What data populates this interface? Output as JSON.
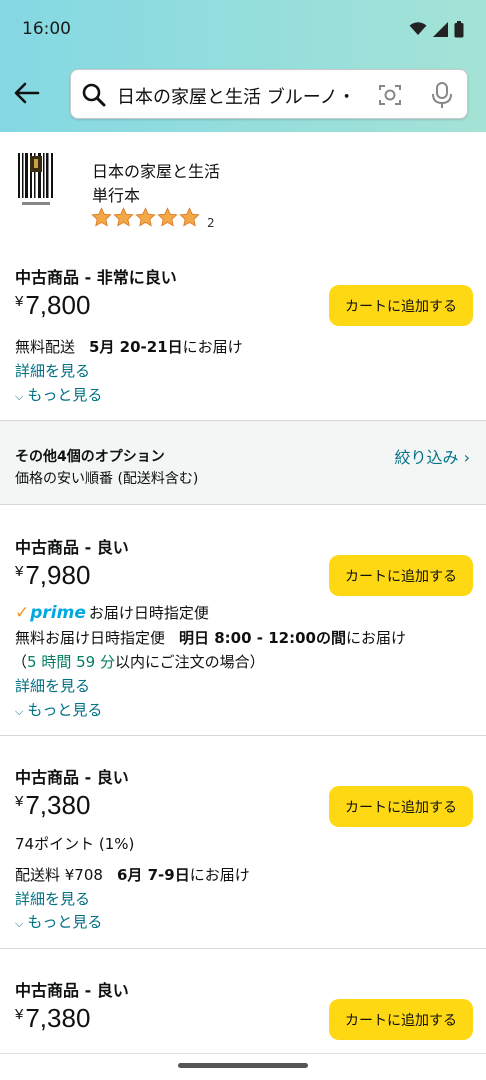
{
  "status": {
    "time": "16:00",
    "icons": [
      "wifi-icon",
      "signal-icon",
      "battery-icon"
    ]
  },
  "search": {
    "query": "日本の家屋と生活 ブルーノ・タウト"
  },
  "product": {
    "title": "日本の家屋と生活",
    "format": "単行本",
    "rating_stars": 5,
    "rating_count": "2"
  },
  "offers": [
    {
      "condition": "中古商品 - 非常に良い",
      "yen": "¥",
      "price": "7,800",
      "cart": "カートに追加する",
      "shipping_label": "無料配送",
      "delivery_date": "5月 20-21日",
      "delivery_suffix": "にお届け",
      "details": "詳細を見る",
      "more": "もっと見る"
    },
    {
      "condition": "中古商品 - 良い",
      "yen": "¥",
      "price": "7,980",
      "cart": "カートに追加する",
      "prime_logo": "prime",
      "prime_text": "お届け日時指定便",
      "shipping_label": "無料お届け日時指定便",
      "delivery_date": "明日 8:00 - 12:00の間",
      "delivery_suffix": "にお届け",
      "order_within_open": "（",
      "order_within_time": "5 時間 59 分",
      "order_within_suffix": "以内にご注文の場合）",
      "details": "詳細を見る",
      "more": "もっと見る"
    },
    {
      "condition": "中古商品 - 良い",
      "yen": "¥",
      "price": "7,380",
      "cart": "カートに追加する",
      "points": "74ポイント (1%)",
      "shipping_label": "配送料 ¥708",
      "delivery_date": "6月 7-9日",
      "delivery_suffix": "にお届け",
      "details": "詳細を見る",
      "more": "もっと見る"
    },
    {
      "condition": "中古商品 - 良い",
      "yen": "¥",
      "price": "7,380",
      "cart": "カートに追加する"
    }
  ],
  "options": {
    "title": "その他4個のオプション",
    "subtitle": "価格の安い順番 (配送料含む)",
    "filter": "絞り込み ›"
  },
  "colors": {
    "header": "#84d8e3",
    "cart_button": "#ffd814",
    "link": "#007185",
    "star": "#f3a847"
  }
}
